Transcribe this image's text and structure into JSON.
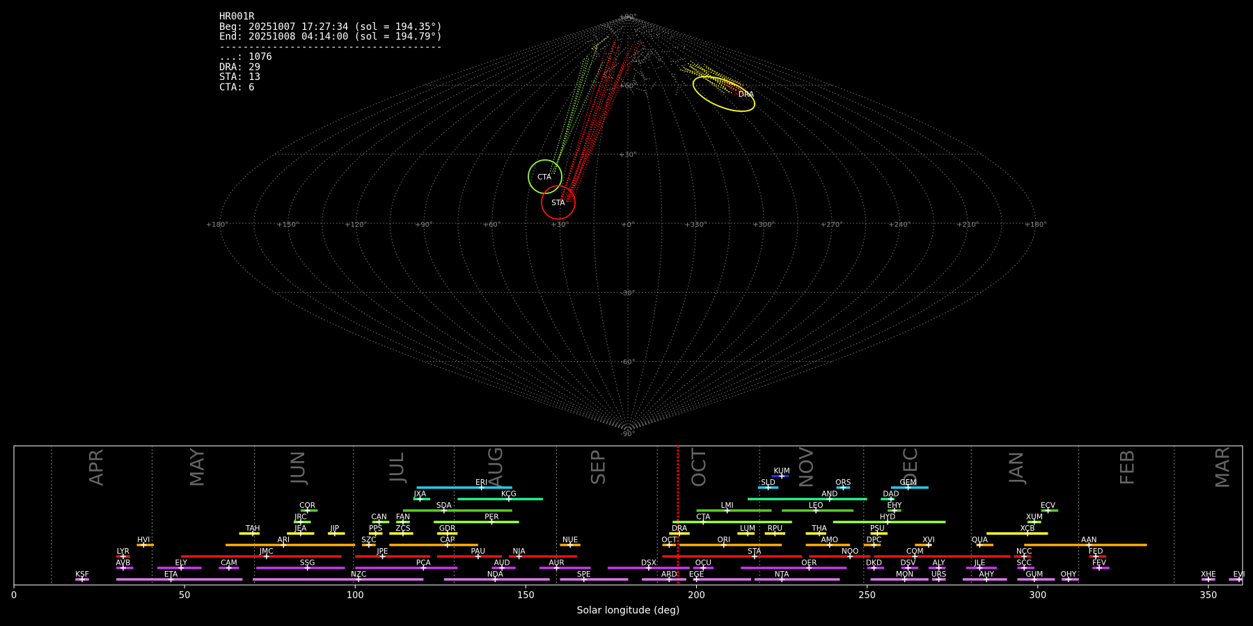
{
  "info": {
    "lines": [
      "HR001R",
      "Beg: 20251007 17:27:34 (sol = 194.35°)",
      "End: 20251008 04:14:00 (sol = 194.79°)",
      "--------------------------------------",
      "...: 1076",
      "DRA: 29",
      "STA: 13",
      "CTA: 6"
    ]
  },
  "sky_map": {
    "projection": "sinusoidal",
    "lon_labels": [
      "+180°",
      "+150°",
      "+120°",
      "+90°",
      "+60°",
      "+30°",
      "+0°",
      "+330°",
      "+300°",
      "+270°",
      "+240°",
      "+210°",
      "+180°"
    ],
    "lat_labels": [
      "+90°",
      "+60°",
      "+30°",
      "-30°",
      "-60°",
      "-90°"
    ],
    "grid_color": "#777777",
    "radiants": [
      {
        "code": "DRA",
        "color": "#ffff22"
      },
      {
        "code": "CTA",
        "color": "#99ff33"
      },
      {
        "code": "STA",
        "color": "#ff1111"
      }
    ]
  },
  "chart_data": {
    "type": "timeline",
    "xlabel": "Solar longitude (deg)",
    "xlim": [
      0,
      360
    ],
    "x_ticks": [
      0,
      50,
      100,
      150,
      200,
      250,
      300,
      350
    ],
    "current_sol": 194.57,
    "month_boundaries": [
      11,
      40.5,
      70.5,
      99.5,
      129,
      159,
      188.5,
      218.5,
      249,
      280.5,
      312,
      340
    ],
    "months": [
      {
        "name": "APR",
        "x": 24.5
      },
      {
        "name": "MAY",
        "x": 54
      },
      {
        "name": "JUN",
        "x": 83.5
      },
      {
        "name": "JUL",
        "x": 112.5
      },
      {
        "name": "AUG",
        "x": 141.5
      },
      {
        "name": "SEP",
        "x": 171.5
      },
      {
        "name": "OCT",
        "x": 201
      },
      {
        "name": "NOV",
        "x": 232.5
      },
      {
        "name": "DEC",
        "x": 263
      },
      {
        "name": "JAN",
        "x": 294
      },
      {
        "name": "FEB",
        "x": 326.5
      },
      {
        "name": "MAR",
        "x": 354.5
      }
    ],
    "colors": {
      "pink": "#dd77ee",
      "magenta": "#cc33ee",
      "red": "#ee1111",
      "orange": "#ffaa00",
      "yellow": "#ffff22",
      "lime": "#99ff33",
      "green": "#55cc22",
      "teal": "#22ee88",
      "cyan": "#22ccee",
      "blue": "#2233cc"
    },
    "showers": [
      {
        "code": "KSF",
        "s": 18,
        "e": 22,
        "p": 20,
        "row": 0,
        "c": "pink"
      },
      {
        "code": "ETA",
        "s": 30,
        "e": 67,
        "p": 46,
        "row": 0,
        "c": "pink"
      },
      {
        "code": "NZC",
        "s": 70,
        "e": 120,
        "p": 101,
        "row": 0,
        "c": "pink"
      },
      {
        "code": "NDA",
        "s": 126,
        "e": 157,
        "p": 141,
        "row": 0,
        "c": "pink"
      },
      {
        "code": "SPE",
        "s": 160,
        "e": 180,
        "p": 167,
        "row": 0,
        "c": "pink"
      },
      {
        "code": "ARD",
        "s": 184,
        "e": 197,
        "p": 192,
        "row": 0,
        "c": "pink"
      },
      {
        "code": "EGE",
        "s": 199,
        "e": 216,
        "p": 200,
        "row": 0,
        "c": "pink"
      },
      {
        "code": "NTA",
        "s": 217,
        "e": 242,
        "p": 225,
        "row": 0,
        "c": "pink"
      },
      {
        "code": "MON",
        "s": 251,
        "e": 268,
        "p": 261,
        "row": 0,
        "c": "pink"
      },
      {
        "code": "URS",
        "s": 269,
        "e": 273,
        "p": 271,
        "row": 0,
        "c": "pink"
      },
      {
        "code": "AHY",
        "s": 278,
        "e": 291,
        "p": 285,
        "row": 0,
        "c": "pink"
      },
      {
        "code": "GUM",
        "s": 294,
        "e": 305,
        "p": 299,
        "row": 0,
        "c": "pink"
      },
      {
        "code": "OHY",
        "s": 307,
        "e": 312,
        "p": 309,
        "row": 0,
        "c": "pink"
      },
      {
        "code": "XHE",
        "s": 348,
        "e": 352,
        "p": 350,
        "row": 0,
        "c": "pink"
      },
      {
        "code": "EVI",
        "s": 356,
        "e": 361,
        "p": 359,
        "row": 0,
        "c": "pink"
      },
      {
        "code": "AVB",
        "s": 30,
        "e": 35,
        "p": 32,
        "row": 1,
        "c": "magenta"
      },
      {
        "code": "ELY",
        "s": 42,
        "e": 55,
        "p": 49,
        "row": 1,
        "c": "magenta"
      },
      {
        "code": "CAM",
        "s": 60,
        "e": 66,
        "p": 63,
        "row": 1,
        "c": "magenta"
      },
      {
        "code": "SSG",
        "s": 71,
        "e": 97,
        "p": 86,
        "row": 1,
        "c": "magenta"
      },
      {
        "code": "PCA",
        "s": 100,
        "e": 130,
        "p": 120,
        "row": 1,
        "c": "magenta"
      },
      {
        "code": "AUD",
        "s": 140,
        "e": 147,
        "p": 143,
        "row": 1,
        "c": "magenta"
      },
      {
        "code": "AUR",
        "s": 154,
        "e": 169,
        "p": 159,
        "row": 1,
        "c": "magenta"
      },
      {
        "code": "DSX",
        "s": 174,
        "e": 198,
        "p": 186,
        "row": 1,
        "c": "magenta"
      },
      {
        "code": "OCU",
        "s": 199,
        "e": 205,
        "p": 202,
        "row": 1,
        "c": "magenta"
      },
      {
        "code": "OER",
        "s": 213,
        "e": 244,
        "p": 233,
        "row": 1,
        "c": "magenta"
      },
      {
        "code": "DKD",
        "s": 250,
        "e": 255,
        "p": 252,
        "row": 1,
        "c": "magenta"
      },
      {
        "code": "DSV",
        "s": 260,
        "e": 265,
        "p": 262,
        "row": 1,
        "c": "magenta"
      },
      {
        "code": "ALY",
        "s": 268,
        "e": 273,
        "p": 271,
        "row": 1,
        "c": "magenta"
      },
      {
        "code": "JLE",
        "s": 279,
        "e": 288,
        "p": 283,
        "row": 1,
        "c": "magenta"
      },
      {
        "code": "SCC",
        "s": 294,
        "e": 299,
        "p": 296,
        "row": 1,
        "c": "magenta"
      },
      {
        "code": "FEV",
        "s": 316,
        "e": 321,
        "p": 318,
        "row": 1,
        "c": "magenta"
      },
      {
        "code": "LYR",
        "s": 30,
        "e": 34,
        "p": 32,
        "row": 2,
        "c": "red"
      },
      {
        "code": "JMC",
        "s": 49,
        "e": 96,
        "p": 74,
        "row": 2,
        "c": "red"
      },
      {
        "code": "JPE",
        "s": 100,
        "e": 122,
        "p": 108,
        "row": 2,
        "c": "red"
      },
      {
        "code": "PAU",
        "s": 124,
        "e": 143,
        "p": 136,
        "row": 2,
        "c": "red"
      },
      {
        "code": "NIA",
        "s": 145,
        "e": 165,
        "p": 148,
        "row": 2,
        "c": "red"
      },
      {
        "code": "STA",
        "s": 190,
        "e": 231,
        "p": 217,
        "row": 2,
        "c": "red"
      },
      {
        "code": "NOO",
        "s": 233,
        "e": 251,
        "p": 245,
        "row": 2,
        "c": "red"
      },
      {
        "code": "COM",
        "s": 252,
        "e": 292,
        "p": 264,
        "row": 2,
        "c": "red"
      },
      {
        "code": "NCC",
        "s": 293,
        "e": 298,
        "p": 296,
        "row": 2,
        "c": "red"
      },
      {
        "code": "FED",
        "s": 315,
        "e": 320,
        "p": 317,
        "row": 2,
        "c": "red"
      },
      {
        "code": "HVI",
        "s": 36,
        "e": 41,
        "p": 38,
        "row": 3,
        "c": "orange"
      },
      {
        "code": "ARI",
        "s": 62,
        "e": 100,
        "p": 79,
        "row": 3,
        "c": "orange"
      },
      {
        "code": "SZC",
        "s": 102,
        "e": 106,
        "p": 104,
        "row": 3,
        "c": "orange"
      },
      {
        "code": "CAP",
        "s": 110,
        "e": 136,
        "p": 127,
        "row": 3,
        "c": "orange"
      },
      {
        "code": "NUE",
        "s": 160,
        "e": 166,
        "p": 163,
        "row": 3,
        "c": "orange"
      },
      {
        "code": "OCT",
        "s": 190,
        "e": 194,
        "p": 192,
        "row": 3,
        "c": "orange"
      },
      {
        "code": "ORI",
        "s": 195,
        "e": 225,
        "p": 208,
        "row": 3,
        "c": "orange"
      },
      {
        "code": "AMO",
        "s": 232,
        "e": 245,
        "p": 239,
        "row": 3,
        "c": "orange"
      },
      {
        "code": "DPC",
        "s": 249,
        "e": 254,
        "p": 252,
        "row": 3,
        "c": "orange"
      },
      {
        "code": "XVI",
        "s": 264,
        "e": 269,
        "p": 268,
        "row": 3,
        "c": "orange"
      },
      {
        "code": "QUA",
        "s": 282,
        "e": 287,
        "p": 283,
        "row": 3,
        "c": "orange"
      },
      {
        "code": "AAN",
        "s": 296,
        "e": 332,
        "p": 315,
        "row": 3,
        "c": "orange"
      },
      {
        "code": "TAH",
        "s": 66,
        "e": 72,
        "p": 70,
        "row": 4,
        "c": "yellow"
      },
      {
        "code": "JEA",
        "s": 80,
        "e": 88,
        "p": 84,
        "row": 4,
        "c": "yellow"
      },
      {
        "code": "JIP",
        "s": 92,
        "e": 97,
        "p": 94,
        "row": 4,
        "c": "yellow"
      },
      {
        "code": "PPS",
        "s": 104,
        "e": 108,
        "p": 106,
        "row": 4,
        "c": "yellow"
      },
      {
        "code": "ZCS",
        "s": 110,
        "e": 117,
        "p": 114,
        "row": 4,
        "c": "yellow"
      },
      {
        "code": "GDR",
        "s": 124,
        "e": 130,
        "p": 127,
        "row": 4,
        "c": "yellow"
      },
      {
        "code": "DRA",
        "s": 192,
        "e": 198,
        "p": 195,
        "row": 4,
        "c": "yellow"
      },
      {
        "code": "LUM",
        "s": 212,
        "e": 217,
        "p": 215,
        "row": 4,
        "c": "yellow"
      },
      {
        "code": "RPU",
        "s": 220,
        "e": 226,
        "p": 223,
        "row": 4,
        "c": "yellow"
      },
      {
        "code": "THA",
        "s": 232,
        "e": 238,
        "p": 236,
        "row": 4,
        "c": "yellow"
      },
      {
        "code": "PSU",
        "s": 251,
        "e": 256,
        "p": 253,
        "row": 4,
        "c": "yellow"
      },
      {
        "code": "XCB",
        "s": 285,
        "e": 303,
        "p": 297,
        "row": 4,
        "c": "yellow"
      },
      {
        "code": "JRC",
        "s": 82,
        "e": 87,
        "p": 84,
        "row": 5,
        "c": "lime"
      },
      {
        "code": "CAN",
        "s": 105,
        "e": 110,
        "p": 107,
        "row": 5,
        "c": "lime"
      },
      {
        "code": "FAN",
        "s": 112,
        "e": 116,
        "p": 114,
        "row": 5,
        "c": "lime"
      },
      {
        "code": "PER",
        "s": 123,
        "e": 148,
        "p": 140,
        "row": 5,
        "c": "lime"
      },
      {
        "code": "CTA",
        "s": 193,
        "e": 228,
        "p": 202,
        "row": 5,
        "c": "lime"
      },
      {
        "code": "HYD",
        "s": 240,
        "e": 273,
        "p": 256,
        "row": 5,
        "c": "lime"
      },
      {
        "code": "XUM",
        "s": 297,
        "e": 301,
        "p": 299,
        "row": 5,
        "c": "lime"
      },
      {
        "code": "COR",
        "s": 84,
        "e": 89,
        "p": 86,
        "row": 6,
        "c": "green"
      },
      {
        "code": "SDA",
        "s": 114,
        "e": 146,
        "p": 126,
        "row": 6,
        "c": "green"
      },
      {
        "code": "LMI",
        "s": 200,
        "e": 222,
        "p": 209,
        "row": 6,
        "c": "green"
      },
      {
        "code": "LEO",
        "s": 225,
        "e": 246,
        "p": 235,
        "row": 6,
        "c": "green"
      },
      {
        "code": "EHY",
        "s": 256,
        "e": 260,
        "p": 258,
        "row": 6,
        "c": "green"
      },
      {
        "code": "ECV",
        "s": 301,
        "e": 306,
        "p": 303,
        "row": 6,
        "c": "green"
      },
      {
        "code": "JXA",
        "s": 117,
        "e": 122,
        "p": 119,
        "row": 7,
        "c": "teal"
      },
      {
        "code": "KCG",
        "s": 130,
        "e": 155,
        "p": 145,
        "row": 7,
        "c": "teal"
      },
      {
        "code": "AND",
        "s": 215,
        "e": 250,
        "p": 239,
        "row": 7,
        "c": "teal"
      },
      {
        "code": "DAD",
        "s": 254,
        "e": 258,
        "p": 257,
        "row": 7,
        "c": "teal"
      },
      {
        "code": "ERI",
        "s": 118,
        "e": 146,
        "p": 137,
        "row": 8,
        "c": "cyan"
      },
      {
        "code": "SLD",
        "s": 218,
        "e": 224,
        "p": 221,
        "row": 8,
        "c": "cyan"
      },
      {
        "code": "ORS",
        "s": 241,
        "e": 245,
        "p": 243,
        "row": 8,
        "c": "cyan"
      },
      {
        "code": "GEM",
        "s": 257,
        "e": 268,
        "p": 262,
        "row": 8,
        "c": "cyan"
      },
      {
        "code": "KUM",
        "s": 222,
        "e": 227,
        "p": 225,
        "row": 9,
        "c": "blue"
      }
    ]
  }
}
